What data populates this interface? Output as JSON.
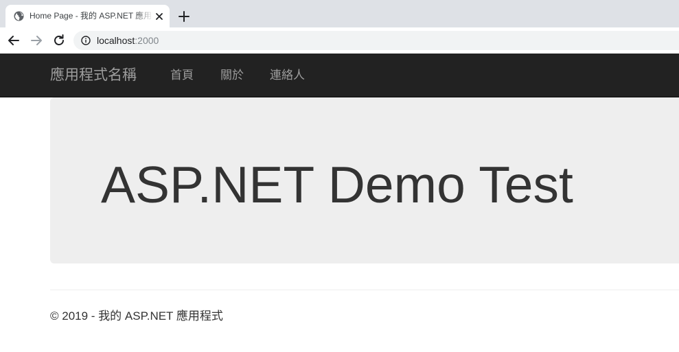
{
  "browser": {
    "tab": {
      "title": "Home Page - 我的 ASP.NET 應用程式",
      "favicon": "globe-icon"
    },
    "new_tab_icon": "plus-icon",
    "close_icon": "close-icon",
    "url": {
      "host": "localhost",
      "port": ":2000"
    },
    "nav_icons": [
      "back-arrow-icon",
      "forward-arrow-icon",
      "reload-icon",
      "info-icon"
    ]
  },
  "navbar": {
    "brand": "應用程式名稱",
    "links": [
      {
        "label": "首頁"
      },
      {
        "label": "關於"
      },
      {
        "label": "連絡人"
      }
    ],
    "background": "#222222",
    "text_color": "#9d9d9d"
  },
  "jumbotron": {
    "title": "ASP.NET Demo Test",
    "background": "#eeeeee"
  },
  "footer": {
    "text": "© 2019 - 我的 ASP.NET 應用程式"
  }
}
